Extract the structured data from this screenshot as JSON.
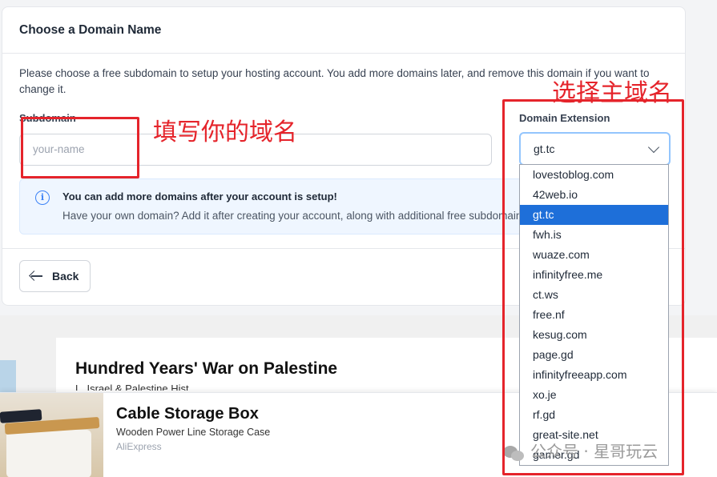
{
  "form": {
    "title": "Choose a Domain Name",
    "intro": "Please choose a free subdomain to setup your hosting account. You add more domains later, and remove this domain if you want to change it.",
    "subdomain_label": "Subdomain",
    "subdomain_placeholder": "your-name",
    "extension_label": "Domain Extension",
    "extension_selected": "gt.tc",
    "info_title": "You can add more domains after your account is setup!",
    "info_text": "Have your own domain? Add it after creating your account, along with additional free subdomains.",
    "back_label": "Back"
  },
  "dropdown": {
    "options": [
      "lovestoblog.com",
      "42web.io",
      "gt.tc",
      "fwh.is",
      "wuaze.com",
      "infinityfree.me",
      "ct.ws",
      "free.nf",
      "kesug.com",
      "page.gd",
      "infinityfreeapp.com",
      "xo.je",
      "rf.gd",
      "great-site.net",
      "gamer.gd"
    ],
    "selected_index": 2
  },
  "article": {
    "title": "Hundred Years' War on Palestine",
    "subtitle": "L. Israel & Palestine Hist..."
  },
  "ad": {
    "title": "Cable Storage Box",
    "subtitle": "Wooden Power Line Storage Case",
    "brand": "AliExpress"
  },
  "annotations": {
    "subdomain_note": "填写你的域名",
    "extension_note": "选择主域名"
  },
  "watermark": "公众号 · 星哥玩云",
  "colors": {
    "annotation": "#e5242b",
    "selected_option": "#1e6fd9",
    "info_icon": "#3b82f6"
  }
}
